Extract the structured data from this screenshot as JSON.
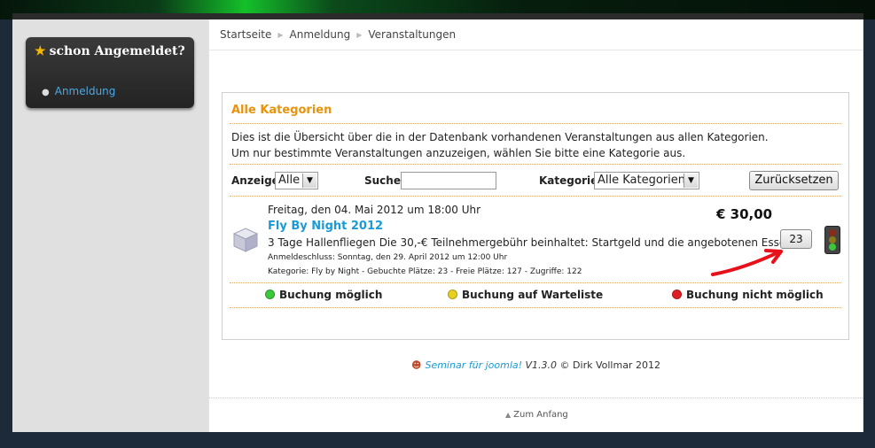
{
  "sidebar": {
    "module_title": "schon Angemeldet?",
    "link": "Anmeldung"
  },
  "breadcrumb": [
    "Startseite",
    "Anmeldung",
    "Veranstaltungen"
  ],
  "category_box": {
    "title": "Alle Kategorien",
    "description_line1": "Dies ist die Übersicht über die in der Datenbank vorhandenen Veranstaltungen aus allen Kategorien.",
    "description_line2": "Um nur bestimmte Veranstaltungen anzuzeigen, wählen Sie bitte eine Kategorie aus."
  },
  "filters": {
    "display_label": "Anzeige",
    "display_value": "Alle",
    "search_label": "Suche:",
    "search_value": "",
    "category_label": "Kategorie:",
    "category_value": "Alle Kategorien",
    "reset_button": "Zurücksetzen"
  },
  "event": {
    "date": "Freitag, den 04. Mai 2012 um 18:00 Uhr",
    "price": "€ 30,00",
    "title": "Fly By Night 2012",
    "description": "3 Tage Hallenfliegen Die 30,-€ Teilnehmergebühr beinhaltet: Startgeld und die angebotenen Essen!",
    "deadline": "Anmeldeschluss: Sonntag, den 29. April 2012 um 12:00 Uhr",
    "meta": "Kategorie: Fly by Night - Gebuchte Plätze: 23 - Freie Plätze: 127 - Zugriffe: 122",
    "places_button": "23",
    "status_icon": "traffic-light-icon"
  },
  "legend": [
    {
      "label": "Buchung möglich",
      "color": "#3cc83c"
    },
    {
      "label": "Buchung auf Warteliste",
      "color": "#e8d020"
    },
    {
      "label": "Buchung nicht möglich",
      "color": "#e02020"
    }
  ],
  "footer": {
    "credit_link": "Seminar für joomla!",
    "credit_version": "V1.3.0",
    "credit_author": "© Dirk Vollmar 2012",
    "to_top": "Zum Anfang"
  },
  "colors": {
    "accent_orange": "#e8930c",
    "link_blue": "#1a9ad6",
    "annotation_red": "#e8101a"
  }
}
